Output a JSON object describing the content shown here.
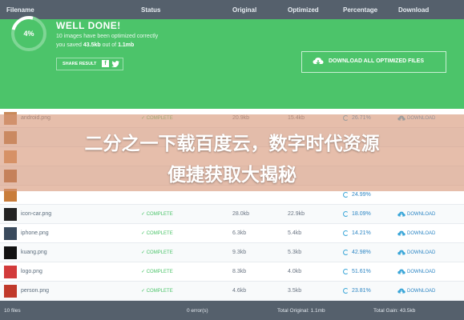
{
  "table_header": {
    "filename": "Filename",
    "status": "Status",
    "original": "Original",
    "optimized": "Optimized",
    "percentage": "Percentage",
    "download": "Download"
  },
  "banner": {
    "progress_label": "4%",
    "progress_fraction": 0.04,
    "title": "WELL DONE!",
    "line1": "10 images have been optimized correctly",
    "line2_prefix": "you saved ",
    "line2_saved": "43.5kb",
    "line2_mid": " out of ",
    "line2_total": "1.1mb",
    "share_label": "SHARE RESULT",
    "download_all_label": "DOWNLOAD ALL OPTIMIZED FILES"
  },
  "rows": [
    {
      "filename": "android.png",
      "status": "COMPLETE",
      "original": "20.9kb",
      "optimized": "15.4kb",
      "percentage": "26.71%",
      "download": "DOWNLOAD",
      "thumb_color": "#c98a5a"
    },
    {
      "filename": "",
      "status": "",
      "original": "",
      "optimized": "",
      "percentage": "",
      "download": "",
      "thumb_color": "#b5733e"
    },
    {
      "filename": "",
      "status": "",
      "original": "",
      "optimized": "",
      "percentage": "",
      "download": "",
      "thumb_color": "#d4894a"
    },
    {
      "filename": "",
      "status": "",
      "original": "",
      "optimized": "",
      "percentage": "",
      "download": "",
      "thumb_color": "#a8602c"
    },
    {
      "filename": "",
      "status": "",
      "original": "",
      "optimized": "",
      "percentage": "24.99%",
      "download": "",
      "thumb_color": "#c97d3b"
    },
    {
      "filename": "icon-car.png",
      "status": "COMPLETE",
      "original": "28.0kb",
      "optimized": "22.9kb",
      "percentage": "18.09%",
      "download": "DOWNLOAD",
      "thumb_color": "#222222"
    },
    {
      "filename": "iphone.png",
      "status": "COMPLETE",
      "original": "6.3kb",
      "optimized": "5.4kb",
      "percentage": "14.21%",
      "download": "DOWNLOAD",
      "thumb_color": "#3a4a5c"
    },
    {
      "filename": "kuang.png",
      "status": "COMPLETE",
      "original": "9.3kb",
      "optimized": "5.3kb",
      "percentage": "42.98%",
      "download": "DOWNLOAD",
      "thumb_color": "#111111"
    },
    {
      "filename": "logo.png",
      "status": "COMPLETE",
      "original": "8.3kb",
      "optimized": "4.0kb",
      "percentage": "51.61%",
      "download": "DOWNLOAD",
      "thumb_color": "#d23b3b"
    },
    {
      "filename": "person.png",
      "status": "COMPLETE",
      "original": "4.6kb",
      "optimized": "3.5kb",
      "percentage": "23.81%",
      "download": "DOWNLOAD",
      "thumb_color": "#c0392b"
    }
  ],
  "footer": {
    "files": "10 files",
    "errors": "0 error(s)",
    "total_original": "Total Original: 1.1mb",
    "total_gain": "Total Gain: 43.5kb"
  },
  "overlay": {
    "line1": "二分之一下载百度云，数字时代资源",
    "line2": "便捷获取大揭秘"
  },
  "colors": {
    "banner": "#4cc46a",
    "header": "#55606c",
    "accent_blue": "#2d86c4",
    "complete_green": "#4cc46a",
    "overlay": "#d69678"
  }
}
